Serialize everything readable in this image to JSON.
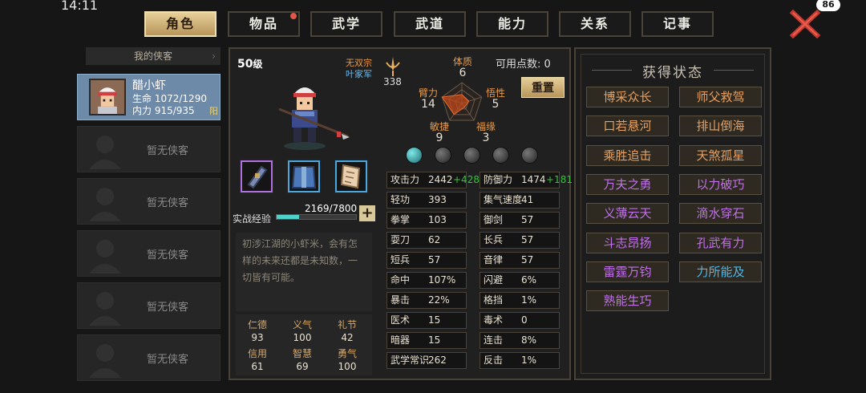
{
  "system": {
    "time": "14:11",
    "battery": "86"
  },
  "tabs": [
    {
      "label": "角色",
      "active": true
    },
    {
      "label": "物品",
      "badge": true
    },
    {
      "label": "武学"
    },
    {
      "label": "武道"
    },
    {
      "label": "能力"
    },
    {
      "label": "关系"
    },
    {
      "label": "记事"
    }
  ],
  "left": {
    "header": "我的侠客",
    "hero": {
      "name": "醋小虾",
      "hp_label": "生命",
      "hp": "1072/1290",
      "mp_label": "内力",
      "mp": "915/935",
      "tag": "阳"
    },
    "empty_label": "暂无侠客"
  },
  "character": {
    "level": "50",
    "level_unit": "级",
    "sect": "无双宗",
    "faction": "叶家军",
    "weapon_value": "338",
    "exp_label": "实战经验",
    "exp": "2169/7800",
    "exp_fraction": 0.278,
    "description": "初涉江湖的小虾米，会有怎样的未来还都是未知数，一切皆有可能。",
    "virtues": [
      {
        "name": "仁德",
        "value": "93"
      },
      {
        "name": "义气",
        "value": "100"
      },
      {
        "name": "礼节",
        "value": "42"
      },
      {
        "name": "信用",
        "value": "61"
      },
      {
        "name": "智慧",
        "value": "69"
      },
      {
        "name": "勇气",
        "value": "100"
      }
    ]
  },
  "attributes": {
    "points_label": "可用点数: 0",
    "reset_label": "重置",
    "items": [
      {
        "name": "体质",
        "value": "6"
      },
      {
        "name": "臂力",
        "value": "14"
      },
      {
        "name": "悟性",
        "value": "5"
      },
      {
        "name": "敏捷",
        "value": "9"
      },
      {
        "name": "福缘",
        "value": "3"
      }
    ]
  },
  "stats": [
    {
      "name": "攻击力",
      "value": "2442",
      "bonus": "+428"
    },
    {
      "name": "防御力",
      "value": "1474",
      "bonus": "+181"
    },
    {
      "name": "轻功",
      "value": "393"
    },
    {
      "name": "集气速度",
      "value": "41"
    },
    {
      "name": "拳掌",
      "value": "103"
    },
    {
      "name": "御剑",
      "value": "57"
    },
    {
      "name": "耍刀",
      "value": "62"
    },
    {
      "name": "长兵",
      "value": "57"
    },
    {
      "name": "短兵",
      "value": "57"
    },
    {
      "name": "音律",
      "value": "57"
    },
    {
      "name": "命中",
      "value": "107%"
    },
    {
      "name": "闪避",
      "value": "6%"
    },
    {
      "name": "暴击",
      "value": "22%"
    },
    {
      "name": "格挡",
      "value": "1%"
    },
    {
      "name": "医术",
      "value": "15"
    },
    {
      "name": "毒术",
      "value": "0"
    },
    {
      "name": "暗器",
      "value": "15"
    },
    {
      "name": "连击",
      "value": "8%"
    },
    {
      "name": "武学常识",
      "value": "262"
    },
    {
      "name": "反击",
      "value": "1%"
    }
  ],
  "status": {
    "title": "获得状态",
    "items": [
      {
        "label": "博采众长",
        "color": "#e8a060"
      },
      {
        "label": "师父救驾",
        "color": "#e8a060"
      },
      {
        "label": "口若悬河",
        "color": "#e8a060"
      },
      {
        "label": "排山倒海",
        "color": "#e8a060"
      },
      {
        "label": "乘胜追击",
        "color": "#e8a060"
      },
      {
        "label": "天煞孤星",
        "color": "#e8a060"
      },
      {
        "label": "万夫之勇",
        "color": "#c070e8"
      },
      {
        "label": "以力破巧",
        "color": "#c070e8"
      },
      {
        "label": "义薄云天",
        "color": "#c070e8"
      },
      {
        "label": "滴水穿石",
        "color": "#c070e8"
      },
      {
        "label": "斗志昂扬",
        "color": "#c070e8"
      },
      {
        "label": "孔武有力",
        "color": "#c070e8"
      },
      {
        "label": "雷霆万钧",
        "color": "#c070e8"
      },
      {
        "label": "力所能及",
        "color": "#50b8e8"
      },
      {
        "label": "熟能生巧",
        "color": "#c070e8"
      }
    ]
  }
}
